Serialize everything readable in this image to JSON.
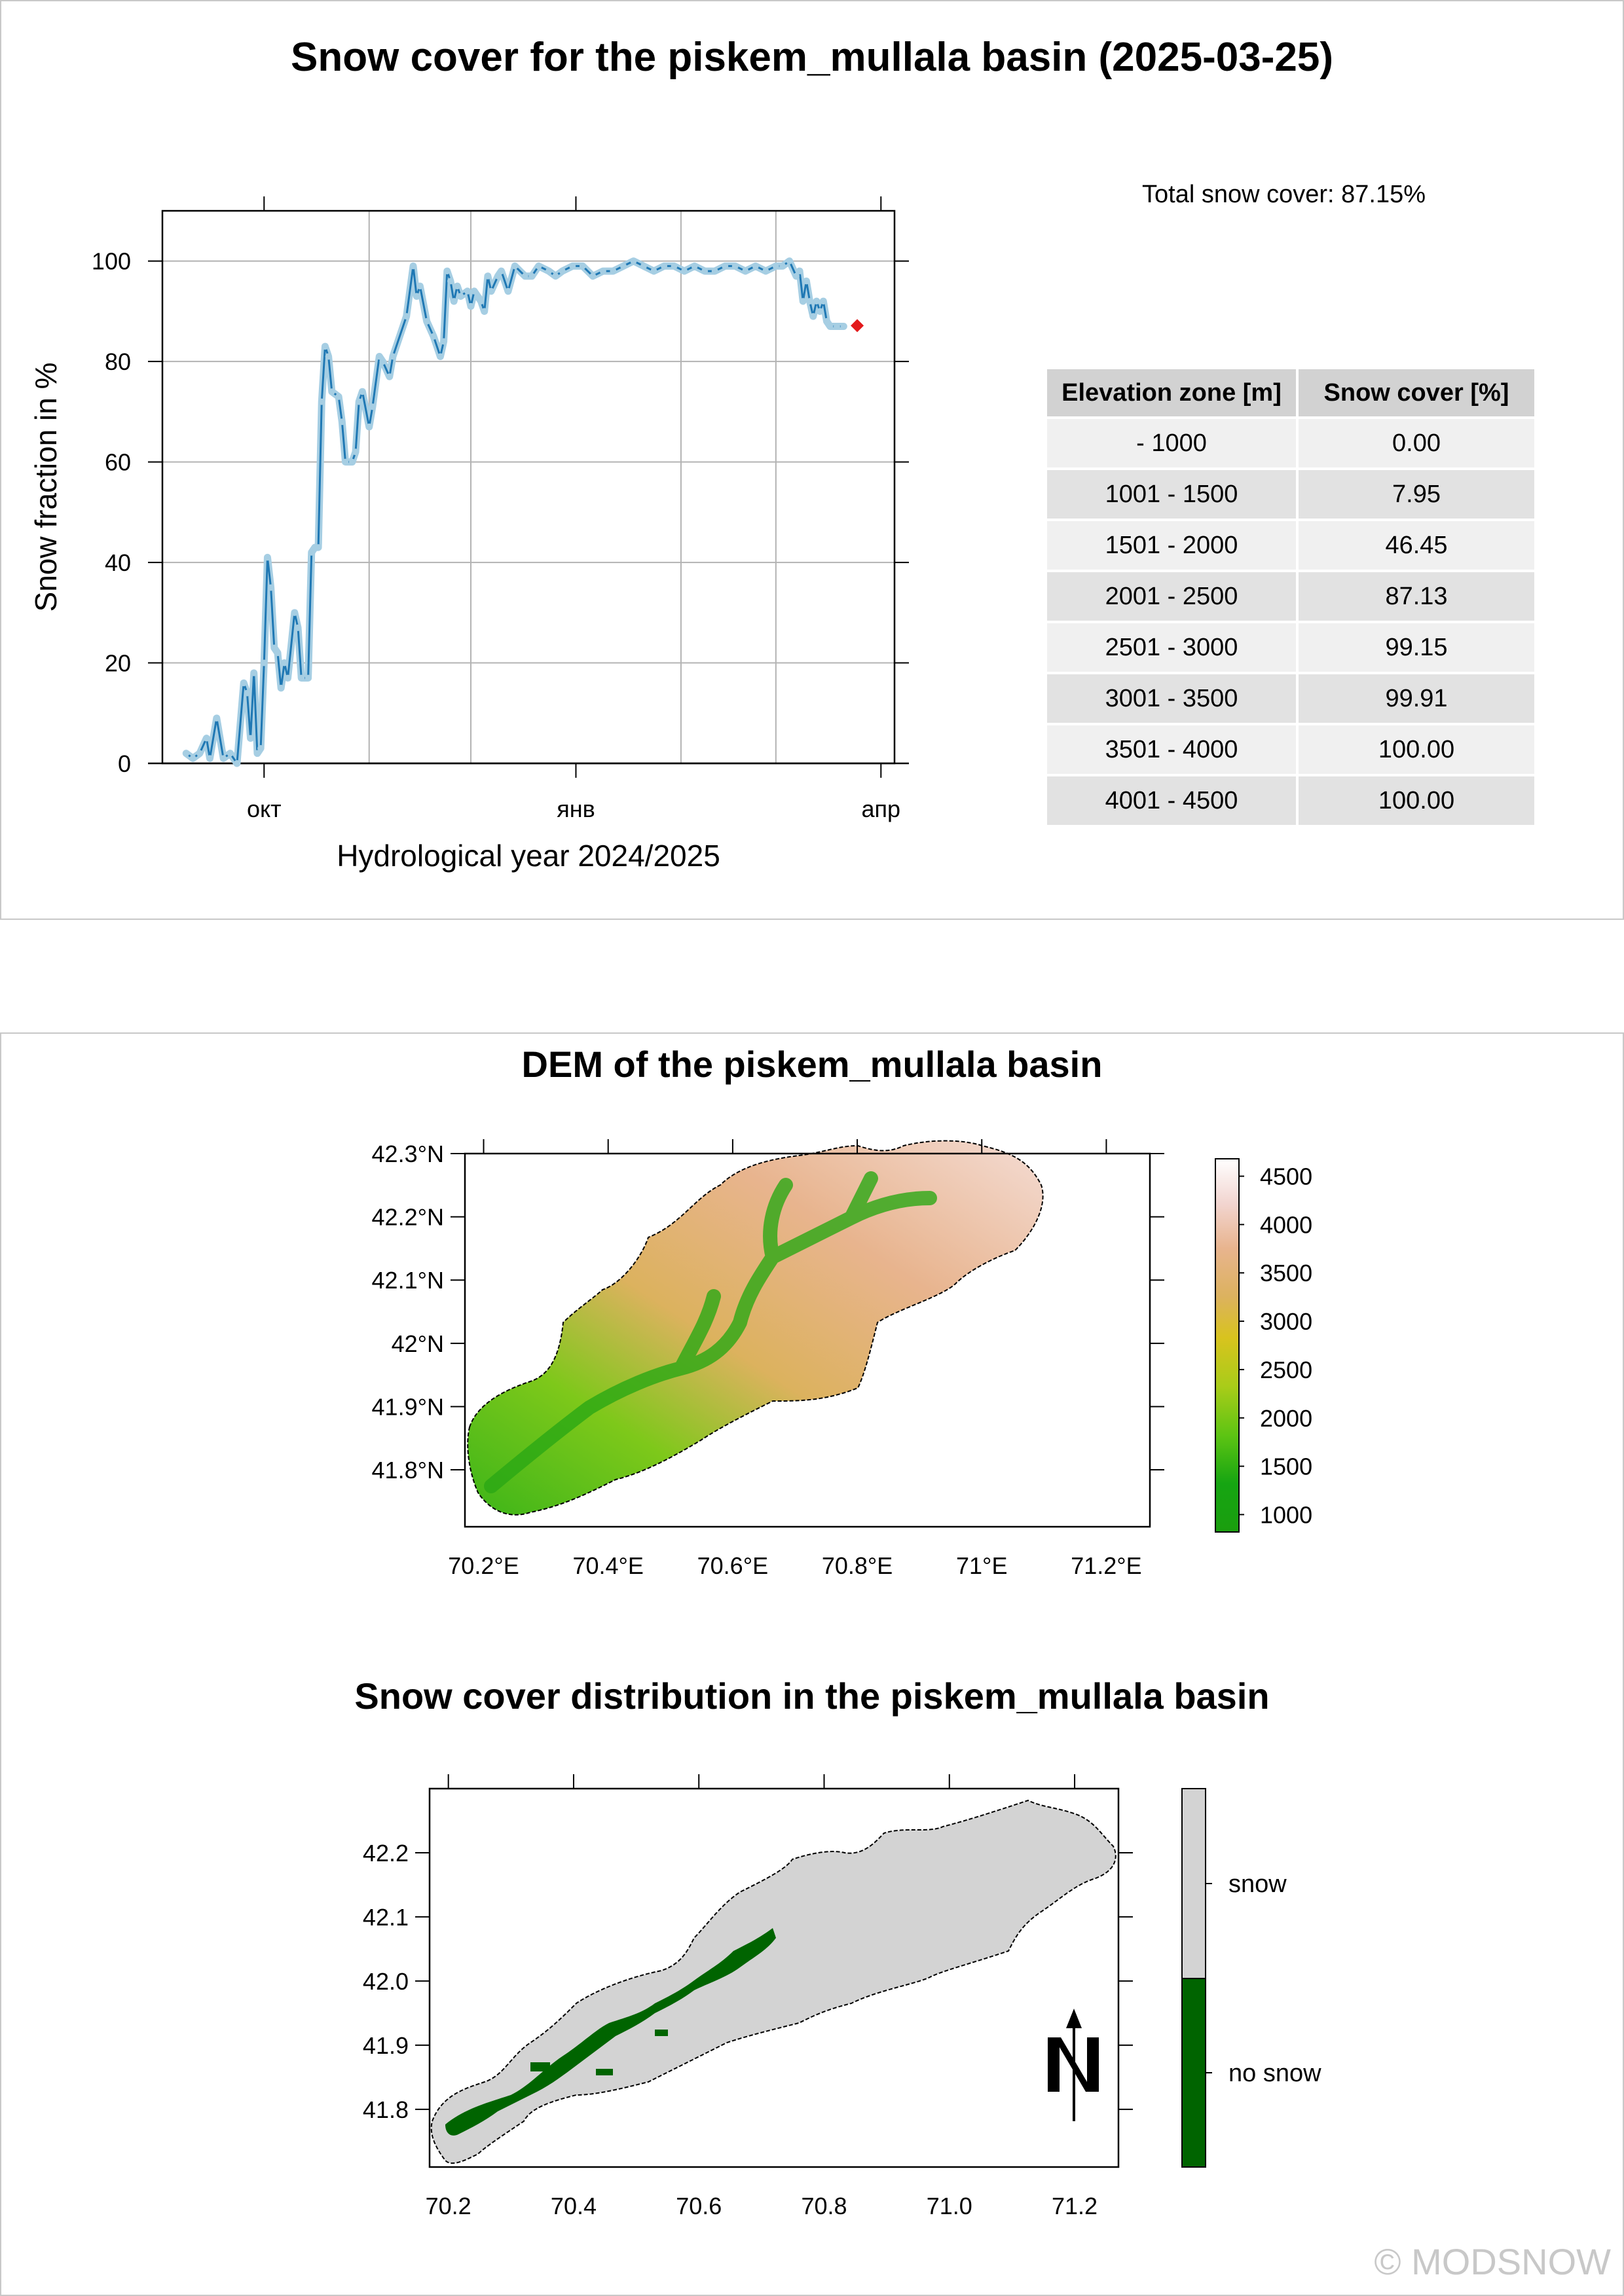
{
  "main_title": "Snow cover for the piskem_mullala basin (2025-03-25)",
  "total_snow_cover": "Total snow cover: 87.15%",
  "table": {
    "headers": [
      "Elevation zone [m]",
      "Snow cover [%]"
    ],
    "rows": [
      [
        "- 1000",
        "0.00"
      ],
      [
        "1001 - 1500",
        "7.95"
      ],
      [
        "1501 - 2000",
        "46.45"
      ],
      [
        "2001 - 2500",
        "87.13"
      ],
      [
        "2501 - 3000",
        "99.15"
      ],
      [
        "3001 - 3500",
        "99.91"
      ],
      [
        "3501 - 4000",
        "100.00"
      ],
      [
        "4001 - 4500",
        "100.00"
      ]
    ]
  },
  "dem_title": "DEM of the piskem_mullala basin",
  "snow_map_title": "Snow cover distribution in the piskem_mullala basin",
  "copyright": "© MODSNOW",
  "colors": {
    "line": "#1f78b4",
    "point_fill": "#a6cee3",
    "current_point": "#e31a1c",
    "snow": "#d3d3d3",
    "no_snow": "#006400",
    "grid": "#b3b3b3"
  },
  "chart_data": [
    {
      "type": "line",
      "title": "",
      "xlabel": "Hydrological year 2024/2025",
      "ylabel": "Snow fraction in %",
      "x_ticks": [
        "окт",
        "янв",
        "апр"
      ],
      "y_ticks": [
        0,
        20,
        40,
        60,
        80,
        100
      ],
      "xlim": [
        "2024-09-01",
        "2025-04-05"
      ],
      "ylim": [
        0,
        110
      ],
      "grid": true,
      "series": [
        {
          "values": [
            {
              "x": "2024-09-08",
              "y": 2
            },
            {
              "x": "2024-09-10",
              "y": 1
            },
            {
              "x": "2024-09-12",
              "y": 2
            },
            {
              "x": "2024-09-14",
              "y": 5
            },
            {
              "x": "2024-09-15",
              "y": 1
            },
            {
              "x": "2024-09-17",
              "y": 9
            },
            {
              "x": "2024-09-19",
              "y": 1
            },
            {
              "x": "2024-09-21",
              "y": 2
            },
            {
              "x": "2024-09-23",
              "y": 0
            },
            {
              "x": "2024-09-25",
              "y": 16
            },
            {
              "x": "2024-09-26",
              "y": 14
            },
            {
              "x": "2024-09-27",
              "y": 5
            },
            {
              "x": "2024-09-28",
              "y": 18
            },
            {
              "x": "2024-09-29",
              "y": 2
            },
            {
              "x": "2024-09-30",
              "y": 3
            },
            {
              "x": "2024-10-01",
              "y": 20
            },
            {
              "x": "2024-10-02",
              "y": 41
            },
            {
              "x": "2024-10-03",
              "y": 35
            },
            {
              "x": "2024-10-04",
              "y": 23
            },
            {
              "x": "2024-10-05",
              "y": 22
            },
            {
              "x": "2024-10-06",
              "y": 15
            },
            {
              "x": "2024-10-07",
              "y": 20
            },
            {
              "x": "2024-10-08",
              "y": 17
            },
            {
              "x": "2024-10-10",
              "y": 30
            },
            {
              "x": "2024-10-11",
              "y": 27
            },
            {
              "x": "2024-10-12",
              "y": 17
            },
            {
              "x": "2024-10-14",
              "y": 17
            },
            {
              "x": "2024-10-15",
              "y": 42
            },
            {
              "x": "2024-10-16",
              "y": 43
            },
            {
              "x": "2024-10-17",
              "y": 43
            },
            {
              "x": "2024-10-18",
              "y": 72
            },
            {
              "x": "2024-10-19",
              "y": 83
            },
            {
              "x": "2024-10-20",
              "y": 81
            },
            {
              "x": "2024-10-21",
              "y": 74
            },
            {
              "x": "2024-10-23",
              "y": 73
            },
            {
              "x": "2024-10-24",
              "y": 68
            },
            {
              "x": "2024-10-25",
              "y": 60
            },
            {
              "x": "2024-10-27",
              "y": 60
            },
            {
              "x": "2024-10-28",
              "y": 62
            },
            {
              "x": "2024-10-29",
              "y": 72
            },
            {
              "x": "2024-10-30",
              "y": 74
            },
            {
              "x": "2024-11-01",
              "y": 67
            },
            {
              "x": "2024-11-02",
              "y": 71
            },
            {
              "x": "2024-11-04",
              "y": 81
            },
            {
              "x": "2024-11-05",
              "y": 80
            },
            {
              "x": "2024-11-07",
              "y": 77
            },
            {
              "x": "2024-11-08",
              "y": 81
            },
            {
              "x": "2024-11-12",
              "y": 89
            },
            {
              "x": "2024-11-14",
              "y": 99
            },
            {
              "x": "2024-11-15",
              "y": 93
            },
            {
              "x": "2024-11-16",
              "y": 95
            },
            {
              "x": "2024-11-18",
              "y": 88
            },
            {
              "x": "2024-11-20",
              "y": 85
            },
            {
              "x": "2024-11-22",
              "y": 81
            },
            {
              "x": "2024-11-23",
              "y": 84
            },
            {
              "x": "2024-11-24",
              "y": 98
            },
            {
              "x": "2024-11-25",
              "y": 96
            },
            {
              "x": "2024-11-26",
              "y": 92
            },
            {
              "x": "2024-11-27",
              "y": 95
            },
            {
              "x": "2024-11-28",
              "y": 93
            },
            {
              "x": "2024-11-30",
              "y": 94
            },
            {
              "x": "2024-12-01",
              "y": 91
            },
            {
              "x": "2024-12-02",
              "y": 94
            },
            {
              "x": "2024-12-03",
              "y": 93
            },
            {
              "x": "2024-12-04",
              "y": 92
            },
            {
              "x": "2024-12-05",
              "y": 90
            },
            {
              "x": "2024-12-06",
              "y": 97
            },
            {
              "x": "2024-12-07",
              "y": 94
            },
            {
              "x": "2024-12-09",
              "y": 97
            },
            {
              "x": "2024-12-10",
              "y": 98
            },
            {
              "x": "2024-12-12",
              "y": 94
            },
            {
              "x": "2024-12-14",
              "y": 99
            },
            {
              "x": "2024-12-17",
              "y": 97
            },
            {
              "x": "2024-12-19",
              "y": 97
            },
            {
              "x": "2024-12-21",
              "y": 99
            },
            {
              "x": "2024-12-24",
              "y": 98
            },
            {
              "x": "2024-12-26",
              "y": 97
            },
            {
              "x": "2024-12-28",
              "y": 98
            },
            {
              "x": "2024-12-31",
              "y": 99
            },
            {
              "x": "2025-01-03",
              "y": 99
            },
            {
              "x": "2025-01-06",
              "y": 97
            },
            {
              "x": "2025-01-09",
              "y": 98
            },
            {
              "x": "2025-01-12",
              "y": 98
            },
            {
              "x": "2025-01-15",
              "y": 99
            },
            {
              "x": "2025-01-18",
              "y": 100
            },
            {
              "x": "2025-01-21",
              "y": 99
            },
            {
              "x": "2025-01-24",
              "y": 98
            },
            {
              "x": "2025-01-27",
              "y": 99
            },
            {
              "x": "2025-01-30",
              "y": 99
            },
            {
              "x": "2025-02-02",
              "y": 98
            },
            {
              "x": "2025-02-05",
              "y": 99
            },
            {
              "x": "2025-02-08",
              "y": 98
            },
            {
              "x": "2025-02-11",
              "y": 98
            },
            {
              "x": "2025-02-14",
              "y": 99
            },
            {
              "x": "2025-02-17",
              "y": 99
            },
            {
              "x": "2025-02-20",
              "y": 98
            },
            {
              "x": "2025-02-23",
              "y": 99
            },
            {
              "x": "2025-02-26",
              "y": 98
            },
            {
              "x": "2025-03-01",
              "y": 99
            },
            {
              "x": "2025-03-03",
              "y": 99
            },
            {
              "x": "2025-03-05",
              "y": 100
            },
            {
              "x": "2025-03-07",
              "y": 97
            },
            {
              "x": "2025-03-08",
              "y": 98
            },
            {
              "x": "2025-03-09",
              "y": 92
            },
            {
              "x": "2025-03-10",
              "y": 96
            },
            {
              "x": "2025-03-11",
              "y": 92
            },
            {
              "x": "2025-03-12",
              "y": 89
            },
            {
              "x": "2025-03-13",
              "y": 92
            },
            {
              "x": "2025-03-14",
              "y": 90
            },
            {
              "x": "2025-03-15",
              "y": 92
            },
            {
              "x": "2025-03-16",
              "y": 88
            },
            {
              "x": "2025-03-17",
              "y": 87
            },
            {
              "x": "2025-03-19",
              "y": 87
            },
            {
              "x": "2025-03-21",
              "y": 87
            }
          ]
        }
      ],
      "current_point": {
        "x": "2025-03-25",
        "y": 87.15
      }
    },
    {
      "type": "heatmap",
      "title": "DEM of the piskem_mullala basin",
      "x_ticks": [
        "70.2°E",
        "70.4°E",
        "70.6°E",
        "70.8°E",
        "71°E",
        "71.2°E"
      ],
      "y_ticks": [
        "42.3°N",
        "42.2°N",
        "42.1°N",
        "42°N",
        "41.9°N",
        "41.8°N"
      ],
      "xlim": [
        70.17,
        71.27
      ],
      "ylim": [
        41.71,
        42.3
      ],
      "legend_ticks": [
        "4500",
        "4000",
        "3500",
        "3000",
        "2500",
        "2000",
        "1500",
        "1000"
      ],
      "legend_colors": [
        "#ffffff",
        "#f2d5d0",
        "#e8b48e",
        "#dcb25e",
        "#d8c31e",
        "#a9cc19",
        "#5ec413",
        "#16a512",
        "#1a9e0e"
      ]
    },
    {
      "type": "heatmap",
      "title": "Snow cover distribution in the piskem_mullala basin",
      "x_ticks": [
        "70.2",
        "70.4",
        "70.6",
        "70.8",
        "71.0",
        "71.2"
      ],
      "y_ticks": [
        "42.2",
        "42.1",
        "42.0",
        "41.9",
        "41.8"
      ],
      "xlim": [
        70.17,
        71.27
      ],
      "ylim": [
        41.71,
        42.3
      ],
      "legend_labels": [
        "snow",
        "no snow"
      ]
    }
  ]
}
